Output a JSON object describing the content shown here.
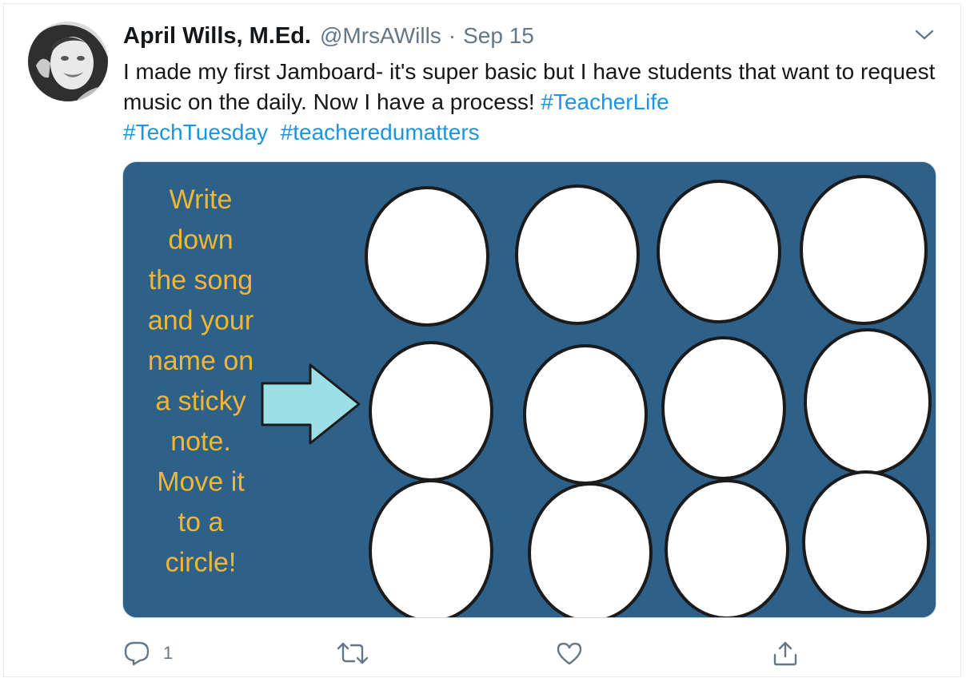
{
  "tweet": {
    "author_name": "April Wills, M.Ed.",
    "handle": "@MrsAWills",
    "separator": "·",
    "date": "Sep 15",
    "text_plain": "I made my first Jamboard- it's super basic but I have students that want to request music on the daily. Now I have a process!",
    "hashtags": [
      "#TeacherLife",
      "#TechTuesday",
      "#teacheredumatters"
    ]
  },
  "media": {
    "board_lines": [
      "Write",
      "down",
      "the song",
      "and your",
      "name on",
      "a sticky",
      "note.",
      "Move it",
      "to a",
      "circle!"
    ],
    "colors": {
      "background": "#2e6189",
      "text": "#f2b632",
      "arrow": "#9ddfe6",
      "circle_fill": "#ffffff",
      "circle_stroke": "#1b1b1b"
    },
    "circle_count": 12
  },
  "actions": {
    "reply_count": "1",
    "icons": [
      "reply-icon",
      "retweet-icon",
      "like-icon",
      "share-icon"
    ]
  },
  "colors": {
    "link": "#1b95e0",
    "muted": "#657786",
    "border": "#e6ecf0"
  }
}
